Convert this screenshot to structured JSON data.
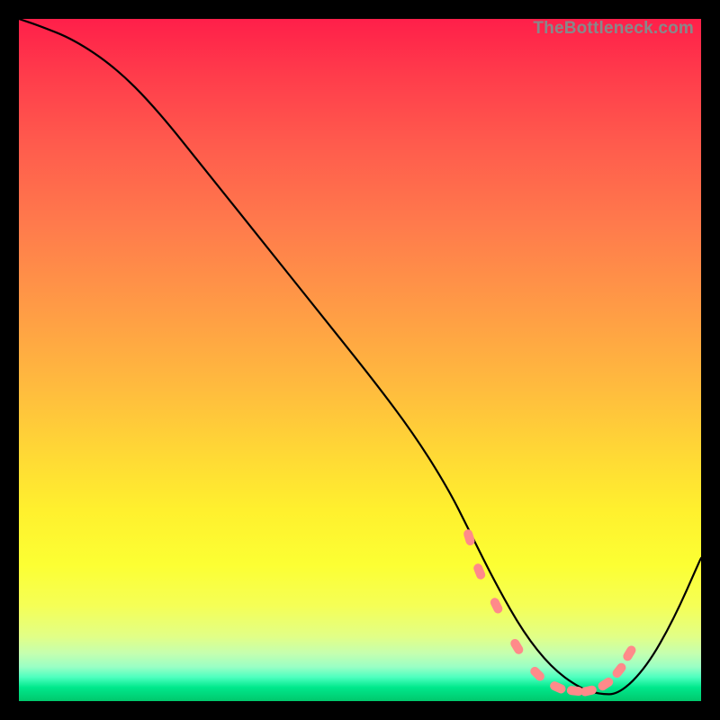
{
  "watermark": "TheBottleneck.com",
  "chart_data": {
    "type": "line",
    "title": "",
    "xlabel": "",
    "ylabel": "",
    "xlim": [
      0,
      100
    ],
    "ylim": [
      0,
      100
    ],
    "series": [
      {
        "name": "curve",
        "x": [
          0,
          3,
          8,
          14,
          20,
          28,
          36,
          44,
          52,
          58,
          63,
          66,
          70,
          74,
          78,
          82,
          85,
          88,
          92,
          96,
          100
        ],
        "y": [
          100,
          99,
          97,
          93,
          87,
          77,
          67,
          57,
          47,
          39,
          31,
          25,
          17,
          10,
          5,
          2,
          1,
          1,
          5,
          12,
          21
        ]
      }
    ],
    "markers": {
      "name": "highlight-dots",
      "color": "#ff8a8a",
      "x": [
        66,
        67.5,
        70,
        73,
        76,
        79,
        81.5,
        83.5,
        86,
        88,
        89.5
      ],
      "y": [
        24,
        19,
        14,
        8,
        4,
        2,
        1.5,
        1.5,
        2.5,
        4.5,
        7
      ]
    },
    "gradient_stops": [
      {
        "pos": 0.0,
        "color": "#ff1f4a"
      },
      {
        "pos": 0.3,
        "color": "#ff7a4c"
      },
      {
        "pos": 0.64,
        "color": "#ffd935"
      },
      {
        "pos": 0.86,
        "color": "#f5ff56"
      },
      {
        "pos": 0.96,
        "color": "#4dffbf"
      },
      {
        "pos": 1.0,
        "color": "#00c86c"
      }
    ]
  }
}
